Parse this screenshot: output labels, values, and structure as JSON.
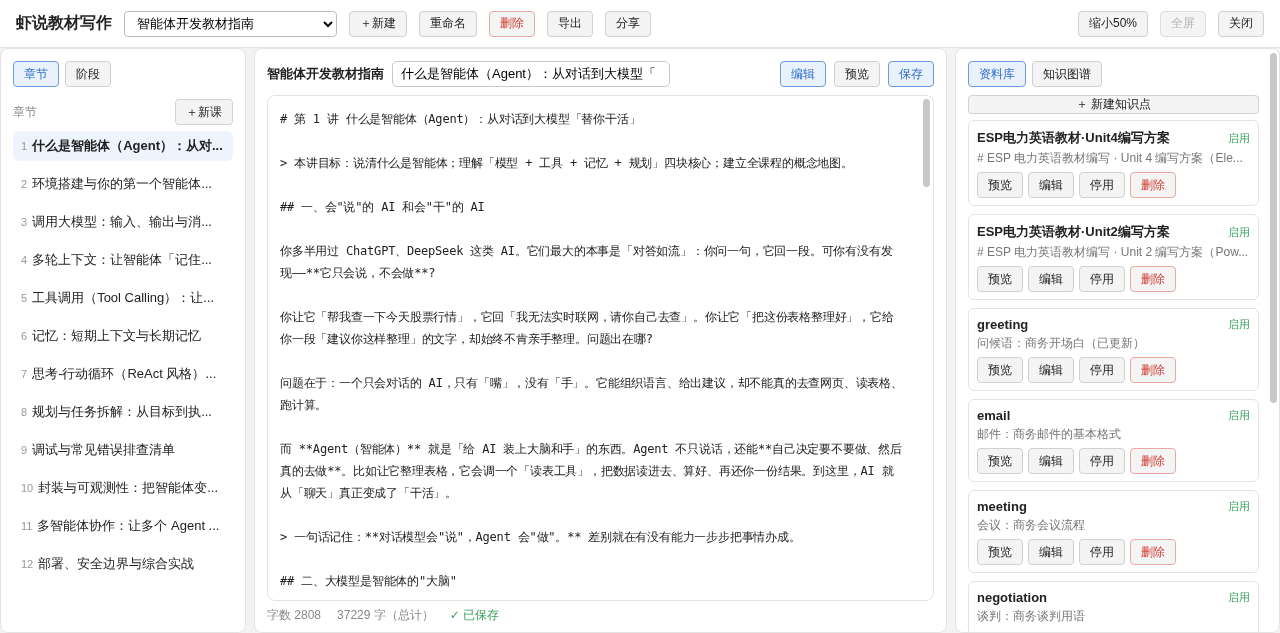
{
  "app_title": "虾说教材写作",
  "textbook_select": {
    "value": "智能体开发教材指南"
  },
  "toolbar_buttons": [
    {
      "label": "＋新建",
      "kind": "normal"
    },
    {
      "label": "重命名",
      "kind": "normal"
    },
    {
      "label": "删除",
      "kind": "danger"
    },
    {
      "label": "导出",
      "kind": "normal"
    },
    {
      "label": "分享",
      "kind": "normal"
    }
  ],
  "window_buttons": [
    {
      "label": "缩小50%",
      "disabled": false
    },
    {
      "label": "全屏",
      "disabled": true
    },
    {
      "label": "关闭",
      "disabled": false
    }
  ],
  "sidebar": {
    "tabs": [
      {
        "label": "章节",
        "selected": true
      },
      {
        "label": "阶段",
        "selected": false
      }
    ],
    "section_label": "章节",
    "new_button": "＋新课",
    "items": [
      {
        "number": "1",
        "title": "什么是智能体（Agent）：从对...",
        "selected": true
      },
      {
        "number": "2",
        "title": "环境搭建与你的第一个智能体...",
        "selected": false
      },
      {
        "number": "3",
        "title": "调用大模型：输入、输出与消...",
        "selected": false
      },
      {
        "number": "4",
        "title": "多轮上下文：让智能体「记住...",
        "selected": false
      },
      {
        "number": "5",
        "title": "工具调用（Tool Calling）：让...",
        "selected": false
      },
      {
        "number": "6",
        "title": "记忆：短期上下文与长期记忆",
        "selected": false
      },
      {
        "number": "7",
        "title": "思考-行动循环（ReAct 风格）...",
        "selected": false
      },
      {
        "number": "8",
        "title": "规划与任务拆解：从目标到执...",
        "selected": false
      },
      {
        "number": "9",
        "title": "调试与常见错误排查清单",
        "selected": false
      },
      {
        "number": "10",
        "title": "封装与可观测性：把智能体变...",
        "selected": false
      },
      {
        "number": "11",
        "title": "多智能体协作：让多个 Agent ...",
        "selected": false
      },
      {
        "number": "12",
        "title": "部署、安全边界与综合实战",
        "selected": false
      }
    ]
  },
  "editor": {
    "book_title": "智能体开发教材指南",
    "lesson_title": "什么是智能体（Agent）：从对话到大模型「",
    "mode_buttons": [
      {
        "label": "编辑",
        "selected": true
      },
      {
        "label": "预览",
        "selected": false
      }
    ],
    "save_button": "保存",
    "paragraphs": [
      "# 第 1 讲  什么是智能体（Agent）：从对话到大模型「替你干活」",
      "> 本讲目标：说清什么是智能体；理解「模型 + 工具 + 记忆 + 规划」四块核心；建立全课程的概念地图。",
      "## 一、会\"说\"的 AI 和会\"干\"的 AI",
      "你多半用过 ChatGPT、DeepSeek 这类 AI。它们最大的本事是「对答如流」：你问一句，它回一段。可你有没有发现——**它只会说，不会做**?",
      "你让它「帮我查一下今天股票行情」，它回「我无法实时联网，请你自己去查」。你让它「把这份表格整理好」，它给你一段「建议你这样整理」的文字，却始终不肯亲手整理。问题出在哪?",
      "问题在于：一个只会对话的 AI，只有「嘴」，没有「手」。它能组织语言、给出建议，却不能真的去查网页、读表格、跑计算。",
      "而 **Agent（智能体）** 就是「给 AI 装上大脑和手」的东西。Agent 不只说话，还能**自己决定要不要做、然后真的去做**。比如让它整理表格，它会调一个「读表工具」，把数据读进去、算好、再还你一份结果。到这里，AI 就从「聊天」真正变成了「干活」。",
      "> 一句话记住：**对话模型会\"说\"，Agent 会\"做\"。** 差别就在有没有能力一步步把事情办成。",
      "## 二、大模型是智能体的\"大脑\""
    ],
    "word_count": "字数 2808",
    "total_count": "37229 字（总计）",
    "save_status": "✓ 已保存"
  },
  "library": {
    "tabs": [
      {
        "label": "资料库",
        "selected": true
      },
      {
        "label": "知识图谱",
        "selected": false
      }
    ],
    "new_button": "＋ 新建知识点",
    "cards": [
      {
        "title": "ESP电力英语教材·Unit4编写方案",
        "status": "启用",
        "description": "# ESP 电力英语教材编写 · Unit 4 编写方案（Ele...",
        "actions": [
          {
            "label": "预览",
            "kind": "normal"
          },
          {
            "label": "编辑",
            "kind": "normal"
          },
          {
            "label": "停用",
            "kind": "normal"
          },
          {
            "label": "删除",
            "kind": "danger"
          }
        ]
      },
      {
        "title": "ESP电力英语教材·Unit2编写方案",
        "status": "启用",
        "description": "# ESP 电力英语教材编写 · Unit 2 编写方案（Pow...",
        "actions": [
          {
            "label": "预览",
            "kind": "normal"
          },
          {
            "label": "编辑",
            "kind": "normal"
          },
          {
            "label": "停用",
            "kind": "normal"
          },
          {
            "label": "删除",
            "kind": "danger"
          }
        ]
      },
      {
        "title": "greeting",
        "status": "启用",
        "description": "问候语：商务开场白（已更新）",
        "actions": [
          {
            "label": "预览",
            "kind": "normal"
          },
          {
            "label": "编辑",
            "kind": "normal"
          },
          {
            "label": "停用",
            "kind": "normal"
          },
          {
            "label": "删除",
            "kind": "danger"
          }
        ]
      },
      {
        "title": "email",
        "status": "启用",
        "description": "邮件：商务邮件的基本格式",
        "actions": [
          {
            "label": "预览",
            "kind": "normal"
          },
          {
            "label": "编辑",
            "kind": "normal"
          },
          {
            "label": "停用",
            "kind": "normal"
          },
          {
            "label": "删除",
            "kind": "danger"
          }
        ]
      },
      {
        "title": "meeting",
        "status": "启用",
        "description": "会议：商务会议流程",
        "actions": [
          {
            "label": "预览",
            "kind": "normal"
          },
          {
            "label": "编辑",
            "kind": "normal"
          },
          {
            "label": "停用",
            "kind": "normal"
          },
          {
            "label": "删除",
            "kind": "danger"
          }
        ]
      },
      {
        "title": "negotiation",
        "status": "启用",
        "description": "谈判：商务谈判用语"
      }
    ]
  }
}
